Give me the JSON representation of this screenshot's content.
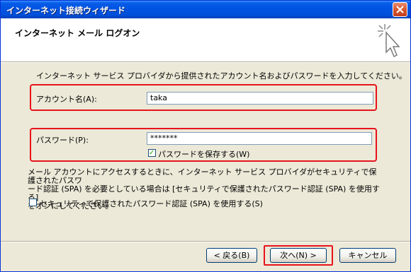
{
  "window": {
    "title": "インターネット接続ウィザード"
  },
  "header": {
    "title": "インターネット メール ログオン"
  },
  "instruction": "インターネット サービス プロバイダから提供されたアカウント名およびパスワードを入力してください。",
  "account": {
    "label": "アカウント名(A):",
    "value": "taka"
  },
  "password": {
    "label": "パスワード(P):",
    "value": "*******",
    "save_checkbox_label": "パスワードを保存する(W)",
    "save_checked": true
  },
  "note": {
    "line1": "メール アカウントにアクセスするときに、インターネット サービス プロバイダがセキュリティで保護されたパスワ",
    "line2": "ード認証 (SPA) を必要としている場合は [セキュリティで保護されたパスワード認証 (SPA) を使用する]",
    "line3": "をオンにしてください。"
  },
  "spa": {
    "label": "セキュリティで保護されたパスワード認証 (SPA) を使用する(S)",
    "checked": false
  },
  "buttons": {
    "back": "< 戻る(B)",
    "next": "次へ(N) >",
    "cancel": "キャンセル"
  },
  "colors": {
    "titlebar": "#0054e3",
    "highlight": "#e8131b",
    "dialog_bg": "#ece9d8"
  }
}
